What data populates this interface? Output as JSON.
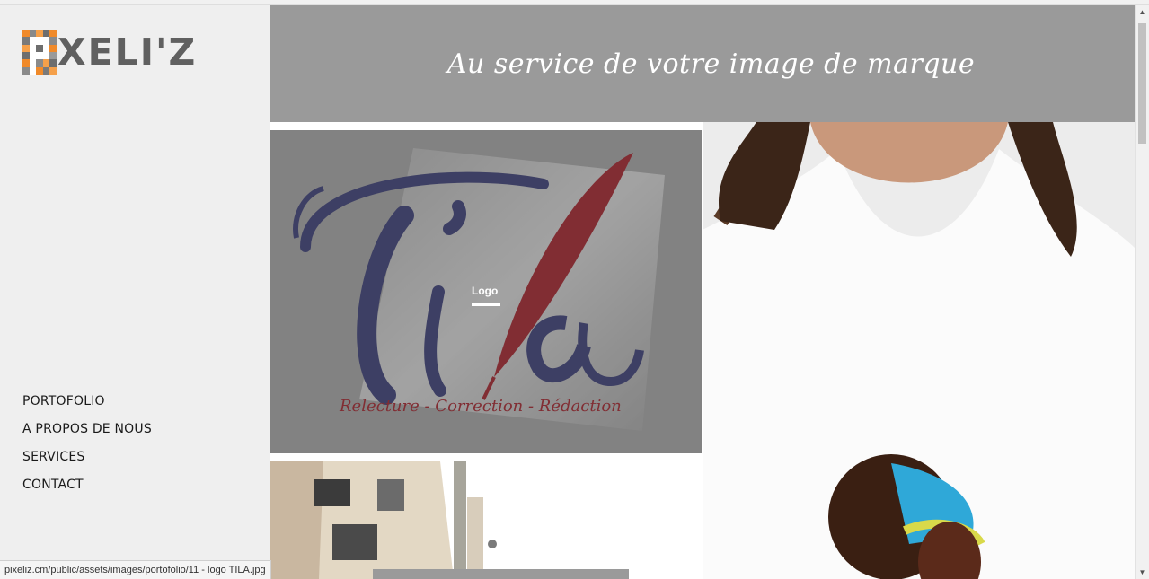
{
  "brand": {
    "logo_text": "XELI'Z"
  },
  "banner": {
    "tagline": "Au service de votre image de marque"
  },
  "nav": {
    "items": [
      {
        "label": "PORTOFOLIO"
      },
      {
        "label": "A PROPOS DE NOUS"
      },
      {
        "label": "SERVICES"
      },
      {
        "label": "CONTACT"
      }
    ]
  },
  "portfolio": {
    "tila": {
      "hover_label": "Logo",
      "logo_word": "Tila",
      "logo_subline": "Relecture - Correction - Rédaction"
    }
  },
  "statusbar": {
    "url": "pixeliz.cm/public/assets/images/portofolio/11 - logo TILA.jpg"
  },
  "colors": {
    "sidebar": "#efefef",
    "banner": "#9a9a9a",
    "navy": "#23255e",
    "crimson": "#8b0a13",
    "orange": "#f07d1d"
  }
}
